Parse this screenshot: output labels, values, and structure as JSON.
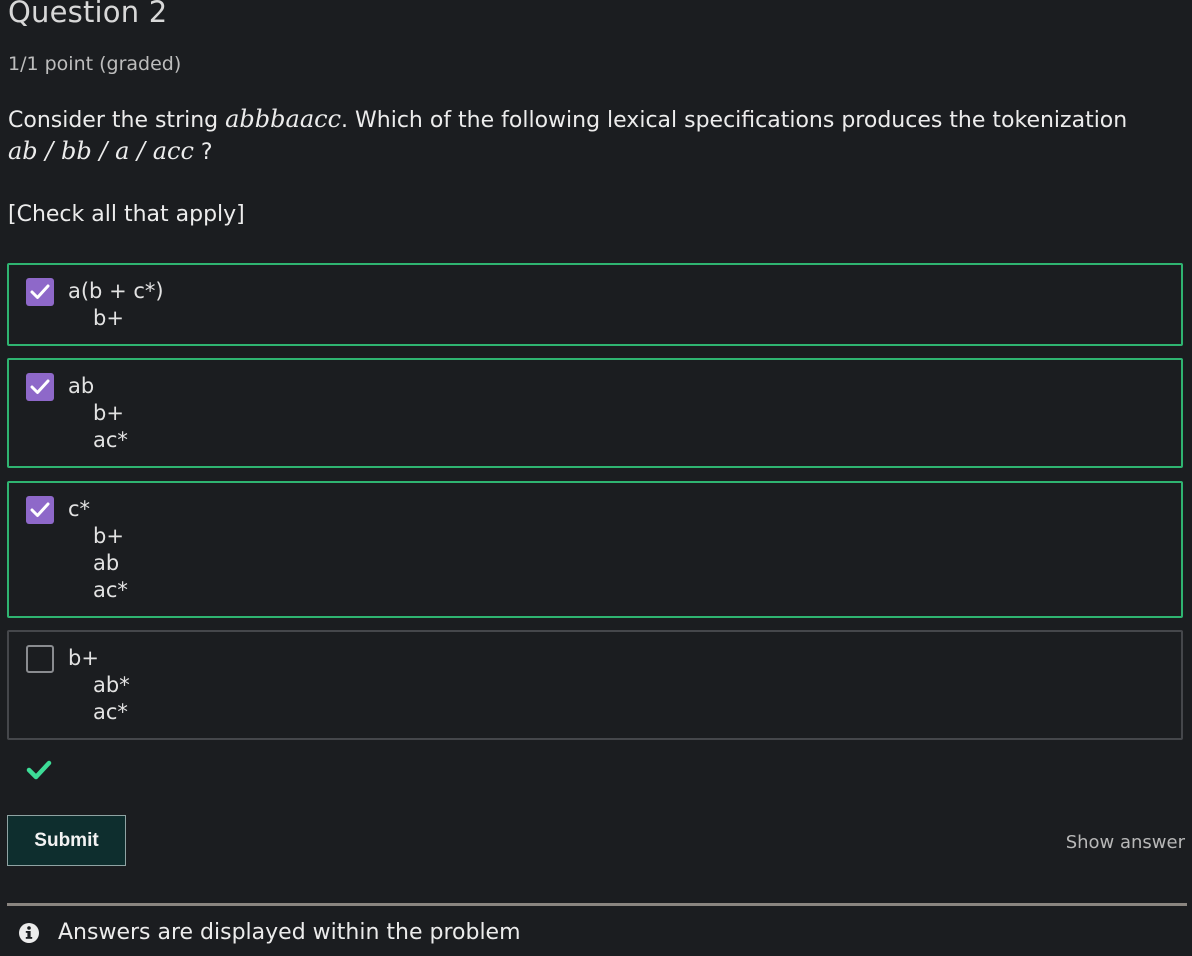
{
  "question": {
    "title": "Question 2",
    "points": "1/1 point (graded)",
    "prompt_before": "Consider the string ",
    "prompt_string": "abbbaacc",
    "prompt_after": ". Which of the following lexical specifications produces the tokenization",
    "tokenization": "ab / bb / a / acc",
    "prompt_end": " ?",
    "instruction": "[Check all that apply]"
  },
  "options": [
    {
      "checked": true,
      "lines": [
        "a(b + c*)",
        "b+"
      ]
    },
    {
      "checked": true,
      "lines": [
        "ab",
        "b+",
        "ac*"
      ]
    },
    {
      "checked": true,
      "lines": [
        "c*",
        "b+",
        "ab",
        "ac*"
      ]
    },
    {
      "checked": false,
      "lines": [
        "b+",
        "ab*",
        "ac*"
      ]
    }
  ],
  "status": {
    "icon": "check-icon",
    "color": "#3ddc97"
  },
  "actions": {
    "submit_label": "Submit",
    "show_answer_label": "Show answer"
  },
  "notice": {
    "icon": "info-icon",
    "text": "Answers are displayed within the problem"
  },
  "colors": {
    "background": "#1b1d20",
    "correct_border": "#2fb471",
    "checkbox_checked": "#8e68c9",
    "submit_bg": "#0e2e2e"
  }
}
